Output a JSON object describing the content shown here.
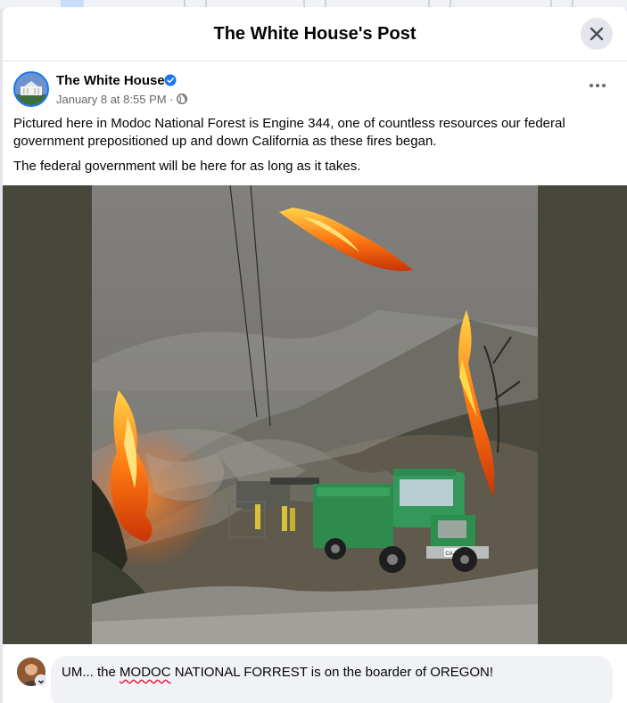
{
  "dialog": {
    "title": "The White House's Post"
  },
  "post": {
    "author": "The White House",
    "timestamp": "January 8 at 8:55 PM",
    "separator": "·",
    "text_paragraph_1": "Pictured here in Modoc National Forest is Engine 344, one of countless resources our federal government prepositioned up and down California as these fires began.",
    "text_paragraph_2": "The federal government will be here for as long as it takes.",
    "photo": {
      "vehicle_label": "CA-MDF"
    }
  },
  "comment_input": {
    "text_before": "UM... the ",
    "text_misspelled": "MODOC",
    "text_after": " NATIONAL FORREST is on the boarder of OREGON!"
  },
  "colors": {
    "accent": "#1877f2",
    "photo_matte": "#47473b"
  },
  "icons": [
    "close-icon",
    "verified-badge-icon",
    "globe-icon",
    "more-options-icon"
  ]
}
